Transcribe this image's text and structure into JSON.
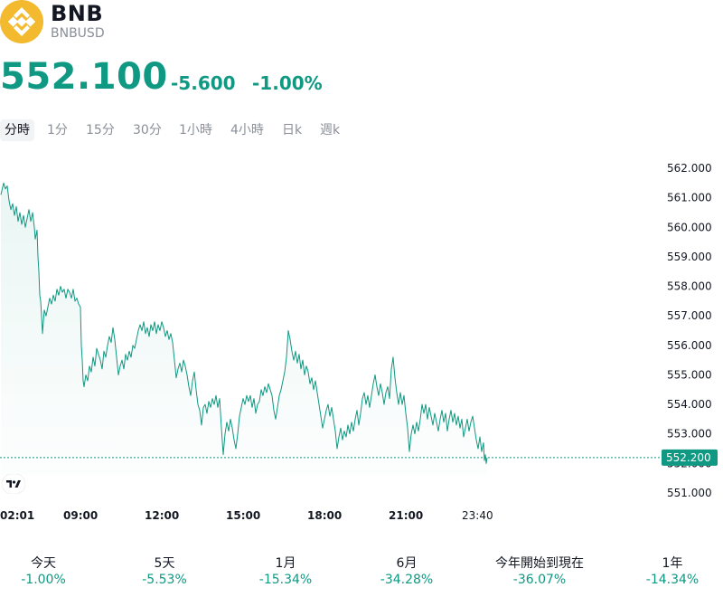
{
  "header": {
    "symbol": "BNB",
    "ticker": "BNBUSD",
    "logo_icon": "binance-coin-icon",
    "logo_color": "#f3ba2f"
  },
  "quote": {
    "price": "552.100",
    "change": "-5.600",
    "change_pct": "-1.00%",
    "color": "#0f9882"
  },
  "tabs": [
    {
      "label": "分時",
      "active": true
    },
    {
      "label": "1分",
      "active": false
    },
    {
      "label": "15分",
      "active": false
    },
    {
      "label": "30分",
      "active": false
    },
    {
      "label": "1小時",
      "active": false
    },
    {
      "label": "4小時",
      "active": false
    },
    {
      "label": "日k",
      "active": false
    },
    {
      "label": "週k",
      "active": false
    }
  ],
  "chart_data": {
    "type": "area",
    "y_ticks": [
      "562.000",
      "561.000",
      "560.000",
      "559.000",
      "558.000",
      "557.000",
      "556.000",
      "555.000",
      "554.000",
      "553.000",
      "552.000",
      "551.000"
    ],
    "ylim": [
      551,
      562
    ],
    "x_ticks": [
      "02:01",
      "09:00",
      "12:00",
      "15:00",
      "18:00",
      "21:00",
      "23:40"
    ],
    "last_value_label": "552.200",
    "last_value": 552.2,
    "line_color": "#0f9882",
    "points": [
      [
        0,
        561.1
      ],
      [
        3,
        561.5
      ],
      [
        5,
        561.3
      ],
      [
        7,
        561.4
      ],
      [
        9,
        560.9
      ],
      [
        11,
        560.6
      ],
      [
        13,
        560.8
      ],
      [
        15,
        560.4
      ],
      [
        17,
        560.7
      ],
      [
        19,
        560.2
      ],
      [
        21,
        560.5
      ],
      [
        23,
        560.1
      ],
      [
        25,
        560.4
      ],
      [
        27,
        560.0
      ],
      [
        29,
        560.3
      ],
      [
        31,
        560.6
      ],
      [
        33,
        560.2
      ],
      [
        35,
        560.5
      ],
      [
        37,
        560.0
      ],
      [
        38,
        559.6
      ],
      [
        40,
        559.9
      ],
      [
        41,
        559.0
      ],
      [
        42,
        558.5
      ],
      [
        43,
        557.7
      ],
      [
        44,
        557.5
      ],
      [
        45,
        557.0
      ],
      [
        46,
        556.4
      ],
      [
        47,
        556.8
      ],
      [
        48,
        557.2
      ],
      [
        50,
        557.0
      ],
      [
        52,
        557.3
      ],
      [
        54,
        557.6
      ],
      [
        56,
        557.4
      ],
      [
        58,
        557.7
      ],
      [
        60,
        557.5
      ],
      [
        62,
        557.9
      ],
      [
        64,
        557.7
      ],
      [
        66,
        558.0
      ],
      [
        68,
        557.8
      ],
      [
        70,
        557.9
      ],
      [
        72,
        557.6
      ],
      [
        74,
        557.9
      ],
      [
        76,
        557.8
      ],
      [
        78,
        557.6
      ],
      [
        80,
        557.9
      ],
      [
        82,
        557.5
      ],
      [
        84,
        557.6
      ],
      [
        86,
        557.4
      ],
      [
        88,
        557.3
      ],
      [
        89,
        556.0
      ],
      [
        90,
        555.5
      ],
      [
        91,
        554.8
      ],
      [
        92,
        554.6
      ],
      [
        94,
        555.0
      ],
      [
        96,
        554.8
      ],
      [
        98,
        555.3
      ],
      [
        100,
        555.1
      ],
      [
        102,
        555.6
      ],
      [
        104,
        555.3
      ],
      [
        106,
        555.9
      ],
      [
        108,
        555.7
      ],
      [
        110,
        555.5
      ],
      [
        112,
        555.2
      ],
      [
        114,
        555.8
      ],
      [
        116,
        555.6
      ],
      [
        118,
        556.0
      ],
      [
        120,
        556.3
      ],
      [
        122,
        556.1
      ],
      [
        124,
        556.6
      ],
      [
        126,
        556.2
      ],
      [
        128,
        555.6
      ],
      [
        130,
        555.0
      ],
      [
        132,
        555.3
      ],
      [
        134,
        555.5
      ],
      [
        136,
        555.2
      ],
      [
        138,
        555.7
      ],
      [
        140,
        555.5
      ],
      [
        142,
        555.8
      ],
      [
        144,
        555.6
      ],
      [
        146,
        556.0
      ],
      [
        148,
        555.9
      ],
      [
        150,
        556.2
      ],
      [
        152,
        556.5
      ],
      [
        154,
        556.7
      ],
      [
        156,
        556.5
      ],
      [
        158,
        556.8
      ],
      [
        160,
        556.4
      ],
      [
        162,
        556.6
      ],
      [
        164,
        556.3
      ],
      [
        166,
        556.7
      ],
      [
        168,
        556.5
      ],
      [
        170,
        556.8
      ],
      [
        172,
        556.4
      ],
      [
        174,
        556.7
      ],
      [
        176,
        556.5
      ],
      [
        178,
        556.8
      ],
      [
        180,
        556.6
      ],
      [
        182,
        556.3
      ],
      [
        184,
        556.5
      ],
      [
        186,
        556.2
      ],
      [
        188,
        556.4
      ],
      [
        190,
        556.1
      ],
      [
        192,
        555.5
      ],
      [
        194,
        554.9
      ],
      [
        196,
        555.2
      ],
      [
        198,
        555.4
      ],
      [
        200,
        555.1
      ],
      [
        202,
        555.5
      ],
      [
        204,
        555.3
      ],
      [
        206,
        555.0
      ],
      [
        208,
        554.6
      ],
      [
        210,
        554.3
      ],
      [
        212,
        554.8
      ],
      [
        214,
        555.1
      ],
      [
        216,
        554.5
      ],
      [
        218,
        554.0
      ],
      [
        220,
        553.8
      ],
      [
        222,
        553.3
      ],
      [
        224,
        553.9
      ],
      [
        226,
        554.0
      ],
      [
        228,
        553.7
      ],
      [
        230,
        554.1
      ],
      [
        232,
        553.9
      ],
      [
        234,
        554.2
      ],
      [
        236,
        554.0
      ],
      [
        238,
        554.3
      ],
      [
        240,
        553.9
      ],
      [
        242,
        554.2
      ],
      [
        244,
        553.2
      ],
      [
        246,
        552.3
      ],
      [
        248,
        553.0
      ],
      [
        250,
        553.4
      ],
      [
        252,
        553.1
      ],
      [
        254,
        553.5
      ],
      [
        256,
        553.2
      ],
      [
        258,
        552.8
      ],
      [
        260,
        552.5
      ],
      [
        262,
        553.0
      ],
      [
        264,
        553.6
      ],
      [
        266,
        553.9
      ],
      [
        268,
        554.2
      ],
      [
        270,
        554.0
      ],
      [
        272,
        554.3
      ],
      [
        274,
        554.1
      ],
      [
        276,
        554.3
      ],
      [
        278,
        553.9
      ],
      [
        280,
        554.2
      ],
      [
        282,
        553.7
      ],
      [
        284,
        554.0
      ],
      [
        286,
        554.1
      ],
      [
        288,
        554.5
      ],
      [
        290,
        554.3
      ],
      [
        292,
        554.6
      ],
      [
        294,
        554.4
      ],
      [
        296,
        554.7
      ],
      [
        298,
        554.5
      ],
      [
        300,
        554.3
      ],
      [
        302,
        553.8
      ],
      [
        304,
        553.5
      ],
      [
        306,
        553.9
      ],
      [
        308,
        554.3
      ],
      [
        310,
        554.5
      ],
      [
        312,
        554.8
      ],
      [
        314,
        555.1
      ],
      [
        316,
        555.6
      ],
      [
        318,
        556.5
      ],
      [
        320,
        556.2
      ],
      [
        322,
        555.8
      ],
      [
        324,
        555.5
      ],
      [
        326,
        555.8
      ],
      [
        328,
        555.4
      ],
      [
        330,
        555.7
      ],
      [
        332,
        555.2
      ],
      [
        334,
        555.5
      ],
      [
        336,
        555.0
      ],
      [
        338,
        555.3
      ],
      [
        340,
        555.1
      ],
      [
        342,
        554.7
      ],
      [
        344,
        554.9
      ],
      [
        346,
        554.5
      ],
      [
        348,
        554.8
      ],
      [
        350,
        554.4
      ],
      [
        352,
        554.0
      ],
      [
        354,
        553.6
      ],
      [
        356,
        553.2
      ],
      [
        358,
        553.5
      ],
      [
        360,
        553.8
      ],
      [
        362,
        554.0
      ],
      [
        364,
        553.6
      ],
      [
        366,
        553.9
      ],
      [
        368,
        553.5
      ],
      [
        370,
        553.1
      ],
      [
        372,
        552.5
      ],
      [
        374,
        552.9
      ],
      [
        376,
        553.2
      ],
      [
        378,
        552.8
      ],
      [
        380,
        553.1
      ],
      [
        382,
        552.9
      ],
      [
        384,
        553.3
      ],
      [
        386,
        553.0
      ],
      [
        388,
        553.4
      ],
      [
        390,
        553.1
      ],
      [
        392,
        553.5
      ],
      [
        394,
        553.8
      ],
      [
        396,
        553.3
      ],
      [
        398,
        553.7
      ],
      [
        400,
        554.2
      ],
      [
        402,
        554.4
      ],
      [
        404,
        554.0
      ],
      [
        406,
        554.3
      ],
      [
        408,
        553.9
      ],
      [
        410,
        554.3
      ],
      [
        412,
        554.7
      ],
      [
        414,
        555.0
      ],
      [
        416,
        554.6
      ],
      [
        418,
        554.3
      ],
      [
        420,
        554.7
      ],
      [
        422,
        554.4
      ],
      [
        424,
        554.0
      ],
      [
        426,
        554.4
      ],
      [
        428,
        554.6
      ],
      [
        430,
        554.2
      ],
      [
        432,
        555.2
      ],
      [
        434,
        555.6
      ],
      [
        436,
        554.9
      ],
      [
        438,
        554.4
      ],
      [
        440,
        554.0
      ],
      [
        442,
        554.4
      ],
      [
        444,
        554.0
      ],
      [
        446,
        554.3
      ],
      [
        448,
        553.7
      ],
      [
        450,
        553.2
      ],
      [
        452,
        552.4
      ],
      [
        454,
        553.0
      ],
      [
        456,
        553.3
      ],
      [
        458,
        553.0
      ],
      [
        460,
        553.4
      ],
      [
        462,
        553.1
      ],
      [
        464,
        553.5
      ],
      [
        466,
        554.0
      ],
      [
        468,
        553.7
      ],
      [
        470,
        554.0
      ],
      [
        472,
        553.5
      ],
      [
        474,
        553.9
      ],
      [
        476,
        553.6
      ],
      [
        478,
        553.3
      ],
      [
        480,
        553.7
      ],
      [
        482,
        553.4
      ],
      [
        484,
        553.1
      ],
      [
        486,
        553.5
      ],
      [
        488,
        553.8
      ],
      [
        490,
        553.4
      ],
      [
        492,
        553.7
      ],
      [
        494,
        553.1
      ],
      [
        496,
        553.5
      ],
      [
        498,
        553.8
      ],
      [
        500,
        553.4
      ],
      [
        502,
        553.7
      ],
      [
        504,
        553.3
      ],
      [
        506,
        553.6
      ],
      [
        508,
        553.2
      ],
      [
        510,
        553.5
      ],
      [
        512,
        552.9
      ],
      [
        514,
        553.2
      ],
      [
        516,
        553.5
      ],
      [
        518,
        553.1
      ],
      [
        520,
        553.4
      ],
      [
        522,
        553.6
      ],
      [
        524,
        553.2
      ],
      [
        526,
        552.8
      ],
      [
        528,
        552.5
      ],
      [
        530,
        552.9
      ],
      [
        532,
        552.4
      ],
      [
        534,
        552.7
      ],
      [
        535,
        552.1
      ],
      [
        536,
        552.3
      ],
      [
        537,
        552.0
      ],
      [
        538,
        552.2
      ]
    ]
  },
  "performance": [
    {
      "label": "今天",
      "value": "-1.00%"
    },
    {
      "label": "5天",
      "value": "-5.53%"
    },
    {
      "label": "1月",
      "value": "-15.34%"
    },
    {
      "label": "6月",
      "value": "-34.28%"
    },
    {
      "label": "今年開始到現在",
      "value": "-36.07%"
    },
    {
      "label": "1年",
      "value": "-14.34%"
    }
  ]
}
